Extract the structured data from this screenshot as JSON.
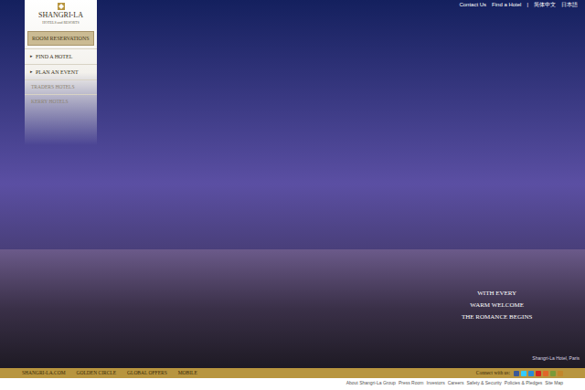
{
  "top_links": [
    {
      "label": "Contact Us"
    },
    {
      "label": "Find a Hotel"
    },
    {
      "label": "|"
    },
    {
      "label": "简体中文"
    },
    {
      "label": "日本語"
    }
  ],
  "logo": {
    "name": "SHANGRI-LA",
    "tagline": "HOTELS and RESORTS"
  },
  "menu": [
    {
      "label": "ROOM RESERVATIONS",
      "marker": "",
      "kind": "button",
      "selected": true
    },
    {
      "label": "FIND A HOTEL",
      "marker": "▸",
      "kind": "link",
      "selected": false
    },
    {
      "label": "PLAN AN EVENT",
      "marker": "▸",
      "kind": "link",
      "selected": false
    },
    {
      "label": "TRADERS HOTELS",
      "marker": "",
      "kind": "brand",
      "selected": false
    },
    {
      "label": "KERRY HOTELS",
      "marker": "",
      "kind": "brand",
      "selected": false
    }
  ],
  "hero": {
    "tagline": [
      "WITH EVERY",
      "WARM WELCOME",
      "THE ROMANCE BEGINS"
    ],
    "caption": "Shangri-La Hotel, Paris"
  },
  "bottom_bar": {
    "links": [
      "SHANGRI-LA.COM",
      "GOLDEN CIRCLE",
      "GLOBAL OFFERS",
      "MOBILE"
    ],
    "connect_label": "Connect with us:",
    "social": [
      {
        "color": "#3b5998"
      },
      {
        "color": "#33ccff"
      },
      {
        "color": "#2a8bd6"
      },
      {
        "color": "#d8261f"
      },
      {
        "color": "#e0662a"
      },
      {
        "color": "#7a9a3a"
      },
      {
        "color": "#c2862c"
      }
    ]
  },
  "footer": {
    "links": [
      "About Shangri-La Group",
      "Press Room",
      "Investors",
      "Careers",
      "Safety & Security",
      "Policies & Pledges",
      "Site Map"
    ]
  }
}
